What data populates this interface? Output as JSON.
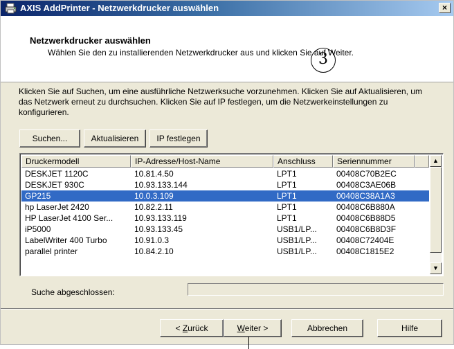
{
  "window": {
    "title": "AXIS AddPrinter - Netzwerkdrucker auswählen",
    "close_label": "×"
  },
  "header": {
    "title": "Netzwerkdrucker auswählen",
    "subtitle": "Wählen Sie den zu installierenden Netzwerkdrucker aus und klicken Sie auf Weiter.",
    "step_number": "3"
  },
  "description": "Klicken Sie auf Suchen, um eine ausführliche Netzwerksuche vorzunehmen. Klicken Sie auf Aktualisieren, um das Netzwerk erneut zu durchsuchen. Klicken Sie auf IP festlegen, um die Netzwerkeinstellungen zu konfigurieren.",
  "toolbar": {
    "search_label": "Suchen...",
    "refresh_label": "Aktualisieren",
    "set_ip_label": "IP festlegen"
  },
  "printer_list": {
    "columns": [
      "Druckermodell",
      "IP-Adresse/Host-Name",
      "Anschluss",
      "Seriennummer"
    ],
    "rows": [
      [
        "DESKJET 1120C",
        "10.81.4.50",
        "LPT1",
        "00408C70B2EC"
      ],
      [
        "DESKJET 930C",
        "10.93.133.144",
        "LPT1",
        "00408C3AE06B"
      ],
      [
        "GP215",
        "10.0.3.109",
        "LPT1",
        "00408C38A1A3"
      ],
      [
        "hp LaserJet 2420",
        "10.82.2.11",
        "LPT1",
        "00408C6B880A"
      ],
      [
        "HP LaserJet 4100 Ser...",
        "10.93.133.119",
        "LPT1",
        "00408C6B88D5"
      ],
      [
        "iP5000",
        "10.93.133.45",
        "USB1/LP...",
        "00408C6B8D3F"
      ],
      [
        "LabelWriter 400 Turbo",
        "10.91.0.3",
        "USB1/LP...",
        "00408C72404E"
      ],
      [
        "parallel printer",
        "10.84.2.10",
        "USB1/LP...",
        "00408C1815E2"
      ]
    ],
    "selected_index": 2
  },
  "status": {
    "label": "Suche abgeschlossen:",
    "progress": 0
  },
  "footer": {
    "back_prefix": "< ",
    "back_accel": "Z",
    "back_rest": "urück",
    "next_accel": "W",
    "next_rest": "eiter >",
    "cancel_label": "Abbrechen",
    "help_label": "Hilfe"
  }
}
